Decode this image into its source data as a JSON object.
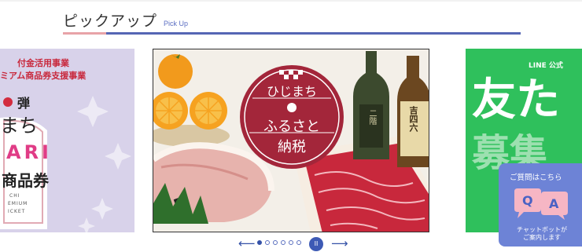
{
  "section": {
    "title": "ピックアップ",
    "subtitle": "Pick Up"
  },
  "slides": {
    "left": {
      "line1": "付金活用事業",
      "line2": "ミアム商品券支援事業",
      "badge": "弾",
      "name": "まち",
      "brand": "ARI",
      "product": "商品券",
      "small1": "CHI",
      "small2": "EMIUM",
      "small3": "ICKET"
    },
    "center": {
      "line1": "ひじまち",
      "line2": "ふるさと",
      "line3": "納税",
      "bottle1": "二階",
      "bottle2": "吉四六"
    },
    "right": {
      "tag": "LINE 公式",
      "big1": "友た",
      "big2": "募集"
    }
  },
  "carousel": {
    "prev_icon": "arrow-left-icon",
    "next_icon": "arrow-right-icon",
    "dot_count": 6,
    "active_index": 0,
    "pause_label": "II"
  },
  "chat": {
    "title": "ご質問はこちら",
    "q": "Q",
    "a": "A",
    "line1": "チャットボットが",
    "line2": "ご案内します"
  },
  "colors": {
    "accent": "#3552a8",
    "chat_bg": "#6d83d6",
    "seal_red": "#a3263a",
    "line_green": "#2fc05c"
  }
}
